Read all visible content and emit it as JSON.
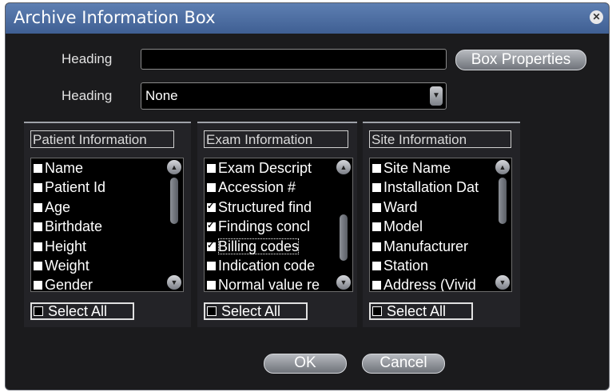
{
  "dialog": {
    "title": "Archive Information Box",
    "close_icon": "close-circle-icon"
  },
  "heading1": {
    "label": "Heading",
    "value": "",
    "button": "Box Properties"
  },
  "heading2": {
    "label": "Heading",
    "selected": "None",
    "dropdown_icon": "chevron-down-icon"
  },
  "groups": [
    {
      "title": "Patient Information",
      "items": [
        {
          "label": "Name",
          "checked": false
        },
        {
          "label": "Patient Id",
          "checked": false
        },
        {
          "label": "Age",
          "checked": false
        },
        {
          "label": "Birthdate",
          "checked": false
        },
        {
          "label": "Height",
          "checked": false
        },
        {
          "label": "Weight",
          "checked": false
        },
        {
          "label": "Gender",
          "checked": false
        }
      ],
      "select_all": "Select All"
    },
    {
      "title": "Exam Information",
      "items": [
        {
          "label": "Exam Descript",
          "checked": false
        },
        {
          "label": "Accession #",
          "checked": false
        },
        {
          "label": "Structured find",
          "checked": true
        },
        {
          "label": "Findings concl",
          "checked": true
        },
        {
          "label": "Billing codes",
          "checked": true
        },
        {
          "label": "Indication code",
          "checked": false
        },
        {
          "label": "Normal value re",
          "checked": false
        }
      ],
      "select_all": "Select All"
    },
    {
      "title": "Site Information",
      "items": [
        {
          "label": "Site Name",
          "checked": false
        },
        {
          "label": "Installation Dat",
          "checked": false
        },
        {
          "label": "Ward",
          "checked": false
        },
        {
          "label": "Model",
          "checked": false
        },
        {
          "label": "Manufacturer",
          "checked": false
        },
        {
          "label": "Station",
          "checked": false
        },
        {
          "label": "Address (Vivid",
          "checked": false
        }
      ],
      "select_all": "Select All"
    }
  ],
  "footer": {
    "ok": "OK",
    "cancel": "Cancel"
  }
}
